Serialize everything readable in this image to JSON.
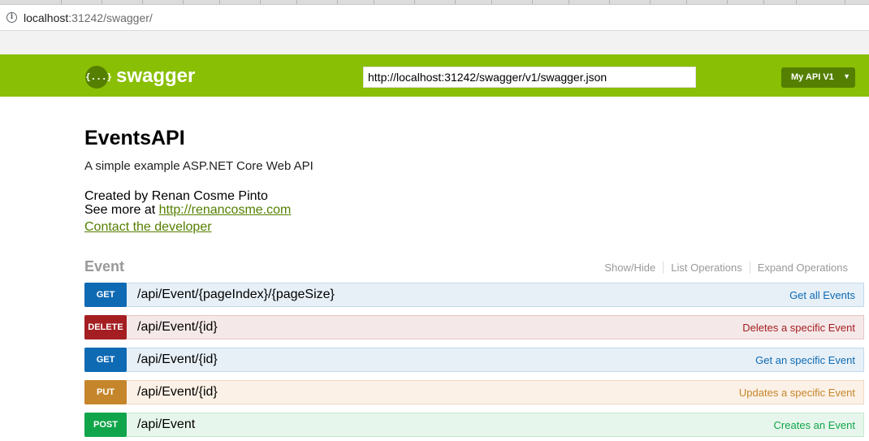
{
  "browser": {
    "url_host": "localhost",
    "url_rest": ":31242/swagger/"
  },
  "header": {
    "logo_glyph": "{...}",
    "title": "swagger",
    "spec_url": "http://localhost:31242/swagger/v1/swagger.json",
    "spec_select": "My API V1",
    "select_arrow": "▼",
    "accent_color": "#89bf04"
  },
  "info": {
    "title": "EventsAPI",
    "description": "A simple example ASP.NET Core Web API",
    "created_by": "Created by Renan Cosme Pinto",
    "see_more_prefix": "See more at ",
    "see_more_link": "http://renancosme.com",
    "contact": "Contact the developer"
  },
  "resource": {
    "name": "Event",
    "options": [
      "Show/Hide",
      "List Operations",
      "Expand Operations"
    ],
    "operations": [
      {
        "method": "GET",
        "path": "/api/Event/{pageIndex}/{pageSize}",
        "summary": "Get all Events"
      },
      {
        "method": "DELETE",
        "path": "/api/Event/{id}",
        "summary": "Deletes a specific Event"
      },
      {
        "method": "GET",
        "path": "/api/Event/{id}",
        "summary": "Get an specific Event"
      },
      {
        "method": "PUT",
        "path": "/api/Event/{id}",
        "summary": "Updates a specific Event"
      },
      {
        "method": "POST",
        "path": "/api/Event",
        "summary": "Creates an Event"
      }
    ]
  }
}
